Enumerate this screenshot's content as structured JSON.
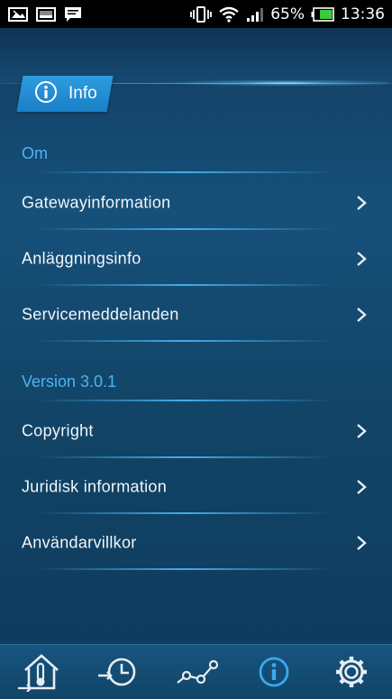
{
  "status_bar": {
    "battery": "65%",
    "time": "13:36",
    "left_icons": [
      "photo-notification-icon",
      "image-notification-icon",
      "message-notification-icon"
    ],
    "right_icons": [
      "vibrate-icon",
      "wifi-icon",
      "signal-icon",
      "battery-icon"
    ]
  },
  "header": {
    "tab_label": "Info",
    "tab_icon": "info-circle-icon"
  },
  "sections": [
    {
      "title": "Om",
      "items": [
        "Gatewayinformation",
        "Anläggningsinfo",
        "Servicemeddelanden"
      ]
    },
    {
      "title": "Version 3.0.1",
      "items": [
        "Copyright",
        "Juridisk information",
        "Användarvillkor"
      ]
    }
  ],
  "bottom_nav": {
    "items": [
      "home-temperature-icon",
      "history-clock-icon",
      "graph-icon",
      "info-icon",
      "settings-gear-icon"
    ],
    "active": "info-icon"
  },
  "colors": {
    "accent": "#4fb3f0",
    "tab": "#1f88cf",
    "background": "#16507a",
    "active_nav": "#3aa8ef"
  }
}
